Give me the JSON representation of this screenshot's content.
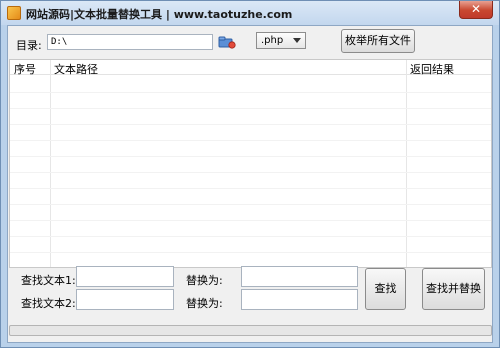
{
  "window": {
    "title": "网站源码|文本批量替换工具  | www.taotuzhe.com",
    "close_glyph": "✕"
  },
  "toolbar": {
    "dir_label": "目录:",
    "dir_value": "D:\\",
    "ext_value": ".php",
    "enum_button": "枚举所有文件"
  },
  "list": {
    "columns": [
      "序号",
      "文本路径",
      "返回结果"
    ],
    "rows": []
  },
  "form": {
    "find1_label": "查找文本1:",
    "find2_label": "查找文本2:",
    "replace1_label": "替换为:",
    "replace2_label": "替换为:",
    "find1_value": "",
    "find2_value": "",
    "replace1_value": "",
    "replace2_value": "",
    "find_button": "查找",
    "find_replace_button": "查找并替换"
  },
  "progress": {
    "value": 0
  }
}
